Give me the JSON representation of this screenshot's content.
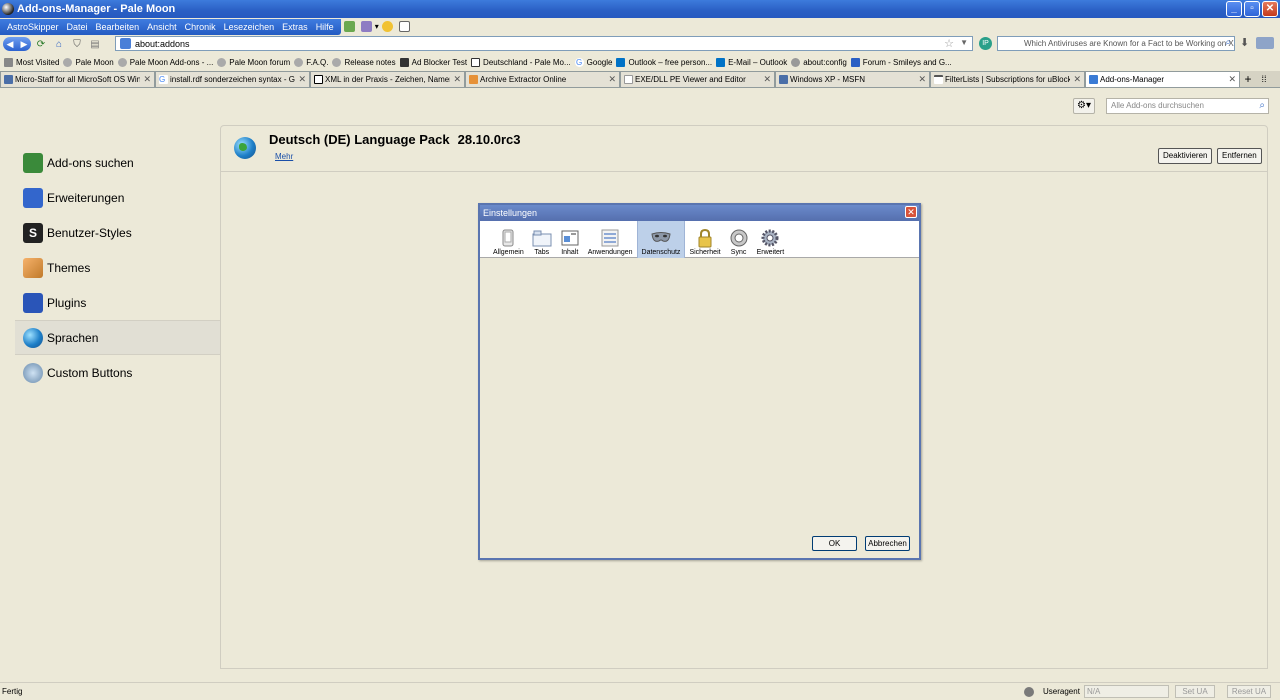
{
  "window": {
    "title": "Add-ons-Manager - Pale Moon"
  },
  "menubar": {
    "items": [
      "AstroSkipper",
      "Datei",
      "Bearbeiten",
      "Ansicht",
      "Chronik",
      "Lesezeichen",
      "Extras",
      "Hilfe"
    ]
  },
  "navbar": {
    "url": "about:addons",
    "search_placeholder": "Which Antiviruses are Known for a Fact to be Working on XP S"
  },
  "bookmarks": [
    "Most Visited",
    "Pale Moon",
    "Pale Moon Add-ons - ...",
    "Pale Moon forum",
    "F.A.Q.",
    "Release notes",
    "Ad Blocker Test",
    "Deutschland - Pale Mo...",
    "Google",
    "Outlook – free person...",
    "E-Mail – Outlook",
    "about:config",
    "Forum - Smileys and G..."
  ],
  "tabs": [
    {
      "label": "Micro-Staff for all MicroSoft OS Window"
    },
    {
      "label": "install.rdf sonderzeichen syntax - Goog"
    },
    {
      "label": "XML in der Praxis - Zeichen, Namen und"
    },
    {
      "label": "Archive Extractor Online"
    },
    {
      "label": "EXE/DLL PE Viewer and Editor"
    },
    {
      "label": "Windows XP - MSFN"
    },
    {
      "label": "FilterLists | Subscriptions for uBlock Ori"
    },
    {
      "label": "Add-ons-Manager"
    }
  ],
  "addons": {
    "search_placeholder": "Alle Add-ons durchsuchen",
    "categories": [
      {
        "label": "Add-ons suchen",
        "icon": "download-icon",
        "color": "#3a8a3a"
      },
      {
        "label": "Erweiterungen",
        "icon": "puzzle-icon",
        "color": "#3366cc"
      },
      {
        "label": "Benutzer-Styles",
        "icon": "stylish-icon",
        "color": "#222222"
      },
      {
        "label": "Themes",
        "icon": "brush-icon",
        "color": "#c07a2a"
      },
      {
        "label": "Plugins",
        "icon": "lego-icon",
        "color": "#2a55b8"
      },
      {
        "label": "Sprachen",
        "icon": "globe-icon",
        "color": "#1e7fc8"
      },
      {
        "label": "Custom Buttons",
        "icon": "custom-buttons-icon",
        "color": "#6688aa"
      }
    ],
    "detail": {
      "name": "Deutsch (DE) Language Pack",
      "version": "28.10.0rc3",
      "more_link": "Mehr",
      "disable_button": "Deaktivieren",
      "remove_button": "Entfernen"
    }
  },
  "dialog": {
    "title": "Einstellungen",
    "panes": [
      {
        "label": "Allgemein",
        "icon": "general-icon"
      },
      {
        "label": "Tabs",
        "icon": "tabs-icon"
      },
      {
        "label": "Inhalt",
        "icon": "content-icon"
      },
      {
        "label": "Anwendungen",
        "icon": "applications-icon"
      },
      {
        "label": "Datenschutz",
        "icon": "privacy-mask-icon"
      },
      {
        "label": "Sicherheit",
        "icon": "padlock-icon"
      },
      {
        "label": "Sync",
        "icon": "sync-icon"
      },
      {
        "label": "Erweitert",
        "icon": "advanced-gear-icon"
      }
    ],
    "selected_pane": "Datenschutz",
    "ok_button": "OK",
    "cancel_button": "Abbrechen"
  },
  "statusbar": {
    "status": "Fertig",
    "useragent_label": "Useragent",
    "useragent_value": "N/A",
    "set_ua": "Set UA",
    "reset_ua": "Reset UA"
  }
}
